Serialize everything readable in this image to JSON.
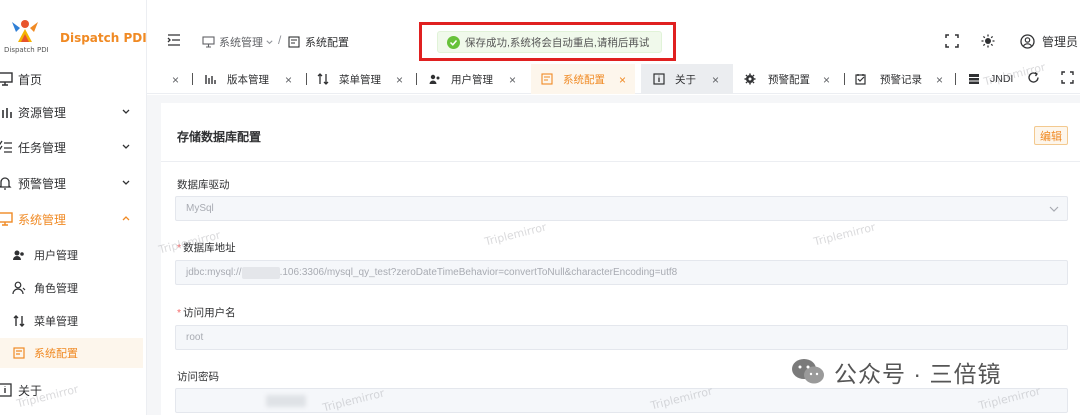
{
  "brand": {
    "logo_sub": "Dispatch PDI",
    "title": "Dispatch PDI"
  },
  "sidebar": {
    "items": [
      {
        "label": "首页"
      },
      {
        "label": "资源管理"
      },
      {
        "label": "任务管理"
      },
      {
        "label": "预警管理"
      },
      {
        "label": "系统管理"
      }
    ],
    "sub_items": [
      {
        "label": "用户管理"
      },
      {
        "label": "角色管理"
      },
      {
        "label": "菜单管理"
      },
      {
        "label": "系统配置"
      }
    ],
    "bottom_item": "关于"
  },
  "header": {
    "breadcrumb": [
      "系统管理",
      "系统配置"
    ],
    "separator": "/",
    "user": "管理员"
  },
  "toast": {
    "message": "保存成功,系统将会自动重启,请稍后再试"
  },
  "tabs": [
    {
      "label": "版本管理"
    },
    {
      "label": "菜单管理"
    },
    {
      "label": "用户管理"
    },
    {
      "label": "系统配置"
    },
    {
      "label": "关于"
    },
    {
      "label": "预警配置"
    },
    {
      "label": "预警记录"
    },
    {
      "label": "JNDI"
    }
  ],
  "tab_close": "×",
  "card": {
    "title": "存储数据库配置",
    "edit_label": "编辑",
    "fields": [
      {
        "label": "数据库驱动",
        "value": "MySql"
      },
      {
        "label": "数据库地址",
        "value_prefix": "jdbc:mysql://",
        "value_suffix": ".106:3306/mysql_qy_test?zeroDateTimeBehavior=convertToNull&characterEncoding=utf8"
      },
      {
        "label": "访问用户名",
        "value": "root"
      },
      {
        "label": "访问密码"
      }
    ],
    "required_mark": "*"
  },
  "watermark": "Triplemirror",
  "wechat_label": "公众号 · 三倍镜",
  "colors": {
    "accent": "#f08a24",
    "success": "#67c23a",
    "highlight": "#e02020"
  }
}
